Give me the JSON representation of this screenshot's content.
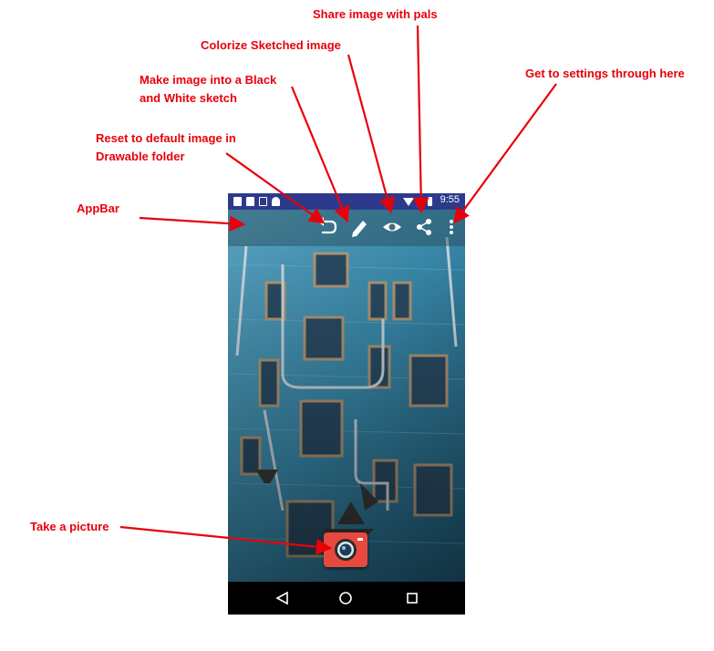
{
  "annotations": {
    "share": "Share image with pals",
    "colorize": "Colorize Sketched image",
    "sketch_line1": "Make image into a Black",
    "sketch_line2": "and White sketch",
    "settings": "Get to settings through here",
    "reset_line1": "Reset to default  image in",
    "reset_line2": "Drawable folder",
    "appbar": "AppBar",
    "take_picture": "Take a picture"
  },
  "status_bar": {
    "time": "9:55"
  },
  "colors": {
    "annotation": "#e8000b",
    "status_bar": "#2d3a8c",
    "camera_button": "#e8493f",
    "wall": "#3f88a9"
  },
  "icons": {
    "app_bar": [
      "undo-icon",
      "pencil-icon",
      "eye-icon",
      "share-icon",
      "more-vert-icon"
    ],
    "fab": "camera-icon",
    "nav": [
      "back-icon",
      "home-icon",
      "recents-icon"
    ]
  }
}
